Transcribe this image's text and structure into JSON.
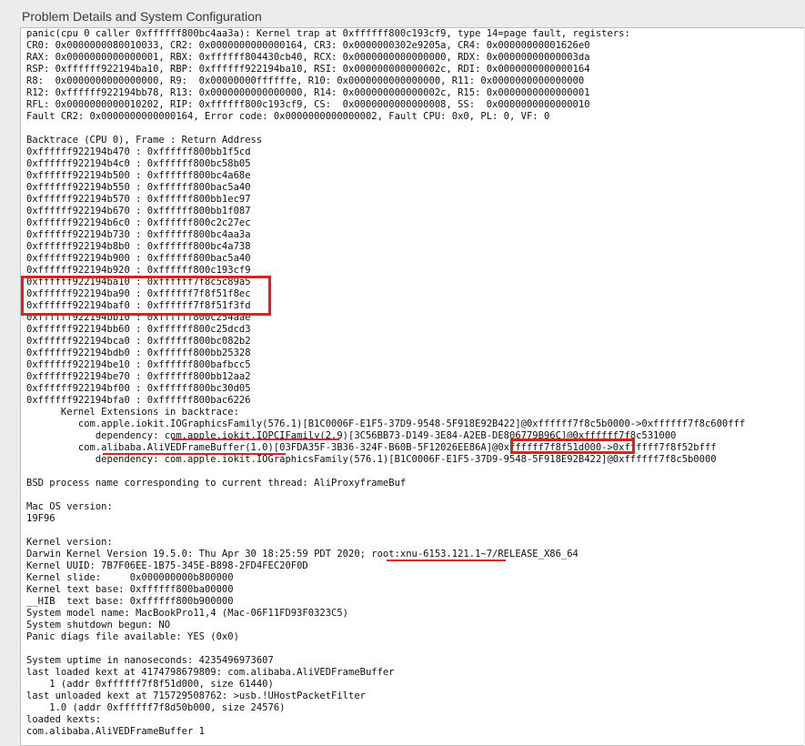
{
  "section_title": "Problem Details and System Configuration",
  "lines": [
    "panic(cpu 0 caller 0xffffff800bc4aa3a): Kernel trap at 0xffffff800c193cf9, type 14=page fault, registers:",
    "CR0: 0x0000000080010033, CR2: 0x0000000000000164, CR3: 0x0000000302e9205a, CR4: 0x00000000001626e0",
    "RAX: 0x0000000000000001, RBX: 0xffffff804430cb40, RCX: 0x0000000000000000, RDX: 0x00000000000003da",
    "RSP: 0xffffff922194ba10, RBP: 0xffffff922194ba10, RSI: 0x000000000000002c, RDI: 0x0000000000000164",
    "R8:  0x0000000000000000, R9:  0x00000000ffffffe, R10: 0x0000000000000000, R11: 0x0000000000000000",
    "R12: 0xffffff922194bb78, R13: 0x0000000000000000, R14: 0x000000000000002c, R15: 0x0000000000000001",
    "RFL: 0x0000000000010202, RIP: 0xffffff800c193cf9, CS:  0x0000000000000008, SS:  0x0000000000000010",
    "Fault CR2: 0x0000000000000164, Error code: 0x0000000000000002, Fault CPU: 0x0, PL: 0, VF: 0",
    "",
    "Backtrace (CPU 0), Frame : Return Address",
    "0xffffff922194b470 : 0xffffff800bb1f5cd",
    "0xffffff922194b4c0 : 0xffffff800bc58b05",
    "0xffffff922194b500 : 0xffffff800bc4a68e",
    "0xffffff922194b550 : 0xffffff800bac5a40",
    "0xffffff922194b570 : 0xffffff800bb1ec97",
    "0xffffff922194b670 : 0xffffff800bb1f087",
    "0xffffff922194b6c0 : 0xffffff800c2c27ec",
    "0xffffff922194b730 : 0xffffff800bc4aa3a",
    "0xffffff922194b8b0 : 0xffffff800bc4a738",
    "0xffffff922194b900 : 0xffffff800bac5a40",
    "0xffffff922194b920 : 0xffffff800c193cf9",
    "0xffffff922194ba10 : 0xffffff7f8c5c89a5",
    "0xffffff922194ba90 : 0xffffff7f8f51f8ec",
    "0xffffff922194baf0 : 0xffffff7f8f51f3fd",
    "0xffffff922194bb10 : 0xffffff800c254aae",
    "0xffffff922194bb60 : 0xffffff800c25dcd3",
    "0xffffff922194bca0 : 0xffffff800bc082b2",
    "0xffffff922194bdb0 : 0xffffff800bb25328",
    "0xffffff922194be10 : 0xffffff800bafbcc5",
    "0xffffff922194be70 : 0xffffff800bb12aa2",
    "0xffffff922194bf00 : 0xffffff800bc30d05",
    "0xffffff922194bfa0 : 0xffffff800bac6226",
    "      Kernel Extensions in backtrace:",
    "         com.apple.iokit.IOGraphicsFamily(576.1)[B1C0006F-E1F5-37D9-9548-5F918E92B422]@0xffffff7f8c5b0000->0xffffff7f8c600fff",
    "            dependency: com.apple.iokit.IOPCIFamily(2.9)[3C56BB73-D149-3E84-A2EB-DE806779B96C]@0xffffff7f8c531000",
    "         com.alibaba.AliVEDFrameBuffer(1.0)[03FDA35F-3B36-324F-B60B-5F12026EE86A]@0xffffff7f8f51d000->0xffffff7f8f52bfff",
    "            dependency: com.apple.iokit.IOGraphicsFamily(576.1)[B1C0006F-E1F5-37D9-9548-5F918E92B422]@0xffffff7f8c5b0000",
    "",
    "BSD process name corresponding to current thread: AliProxyframeBuf",
    "",
    "Mac OS version:",
    "19F96",
    "",
    "Kernel version:",
    "Darwin Kernel Version 19.5.0: Thu Apr 30 18:25:59 PDT 2020; root:xnu-6153.121.1~7/RELEASE_X86_64",
    "Kernel UUID: 7B7F06EE-1B75-345E-B898-2FD4FEC20F0D",
    "Kernel slide:     0x000000000b800000",
    "Kernel text base: 0xffffff800ba00000",
    "__HIB  text base: 0xffffff800b900000",
    "System model name: MacBookPro11,4 (Mac-06F11FD93F0323C5)",
    "System shutdown begun: NO",
    "Panic diags file available: YES (0x0)",
    "",
    "System uptime in nanoseconds: 4235496973607",
    "last loaded kext at 4174798679809: com.alibaba.AliVEDFrameBuffer",
    "    1 (addr 0xffffff7f8f51d000, size 61440)",
    "last unloaded kext at 715729508762: >usb.!UHostPacketFilter",
    "    1.0 (addr 0xffffff7f8d50b000, size 24576)",
    "loaded kexts:",
    "com.alibaba.AliVEDFrameBuffer 1"
  ],
  "highlight_color": "#e0201c"
}
